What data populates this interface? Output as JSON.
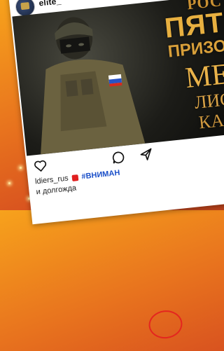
{
  "post": {
    "username": "elite_",
    "image_lines": [
      "РОС",
      "ПЯТ",
      "ПРИЗО",
      "МЕ",
      "ЛИС",
      "КАР"
    ],
    "caption_user": "ldiers_rus",
    "caption_hashtag": "#ВНИМАН",
    "caption_line2": "и долгожда"
  },
  "icons": {
    "avatar": "avatar",
    "like": "heart-icon",
    "comment": "comment-icon",
    "share": "send-icon",
    "alert": "siren-emoji-icon"
  },
  "colors": {
    "background_gradient": [
      "#f7a21c",
      "#d9541f"
    ],
    "title_gold": "#e0a93b",
    "hashtag": "#1a4fc9",
    "highlight": "#e4261f"
  }
}
